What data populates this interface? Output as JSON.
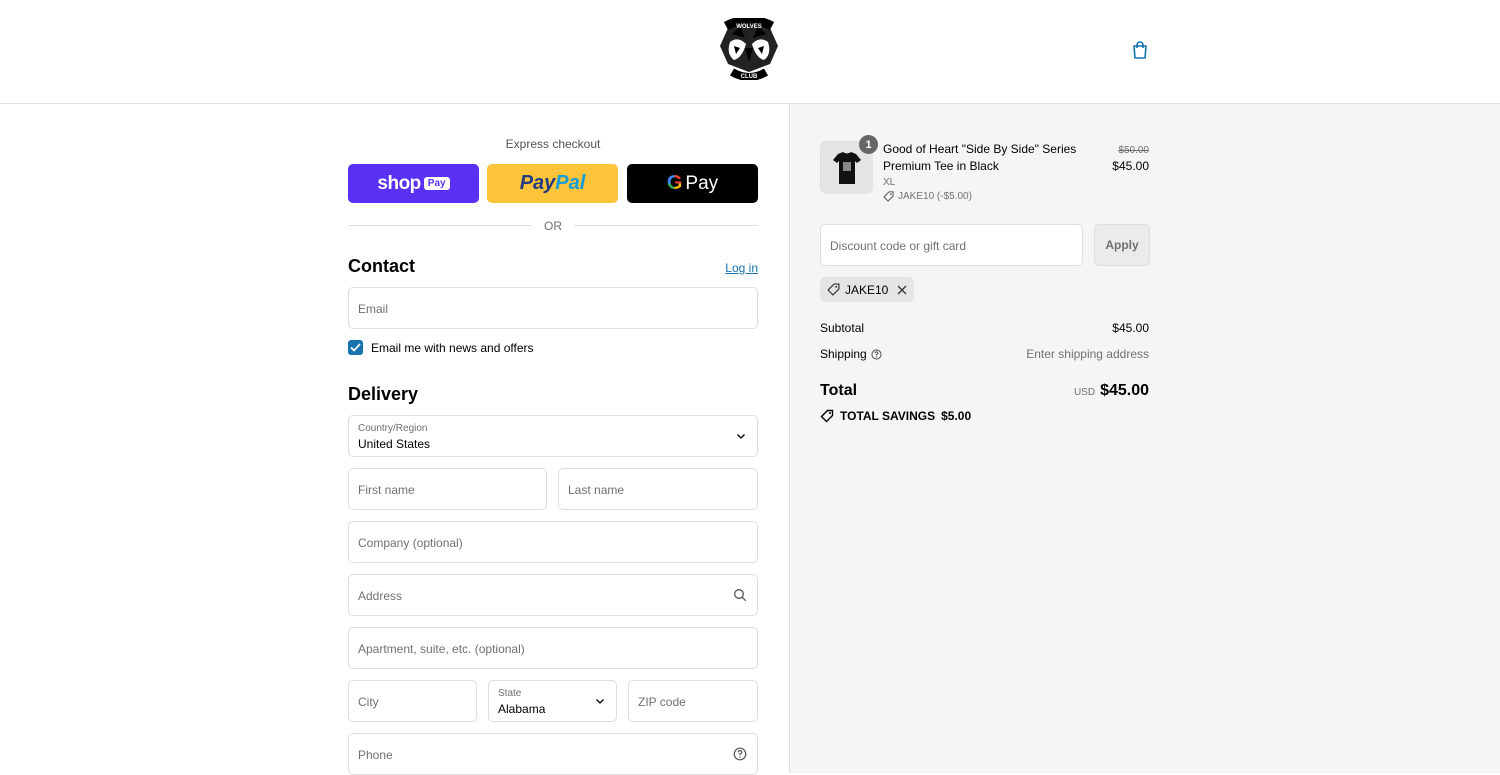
{
  "header": {
    "logo": {
      "icon": "wolves-club-logo-icon",
      "text_top": "WOLVES",
      "text_bottom": "CLUB"
    },
    "cart_icon": "shopping-bag-icon"
  },
  "express": {
    "title": "Express checkout",
    "shop_pay": {
      "word": "shop",
      "badge": "Pay"
    },
    "paypal": {
      "part1": "Pay",
      "part2": "Pal"
    },
    "gpay": {
      "g": "G",
      "pay": "Pay"
    },
    "or_text": "OR"
  },
  "contact": {
    "title": "Contact",
    "login_link": "Log in",
    "email_placeholder": "Email",
    "newsletter_label": "Email me with news and offers",
    "newsletter_checked": true
  },
  "delivery": {
    "title": "Delivery",
    "country_label": "Country/Region",
    "country_value": "United States",
    "first_name_placeholder": "First name",
    "last_name_placeholder": "Last name",
    "company_placeholder": "Company (optional)",
    "address_placeholder": "Address",
    "apartment_placeholder": "Apartment, suite, etc. (optional)",
    "city_placeholder": "City",
    "state_label": "State",
    "state_value": "Alabama",
    "zip_placeholder": "ZIP code",
    "phone_placeholder": "Phone"
  },
  "order": {
    "item": {
      "quantity": "1",
      "title": "Good of Heart \"Side By Side\" Series Premium Tee in Black",
      "variant": "XL",
      "discount": "JAKE10 (-$5.00)",
      "price_original": "$50.00",
      "price": "$45.00"
    },
    "discount_placeholder": "Discount code or gift card",
    "apply_label": "Apply",
    "applied_code": "JAKE10",
    "subtotal_label": "Subtotal",
    "subtotal_value": "$45.00",
    "shipping_label": "Shipping",
    "shipping_value": "Enter shipping address",
    "total_label": "Total",
    "total_currency": "USD",
    "total_value": "$45.00",
    "savings_label": "TOTAL SAVINGS",
    "savings_value": "$5.00"
  },
  "colors": {
    "accent": "#1773b0",
    "shop_pay": "#5a31f4",
    "paypal": "#ffc439",
    "gpay": "#000000",
    "summary_bg": "#f5f5f5"
  }
}
